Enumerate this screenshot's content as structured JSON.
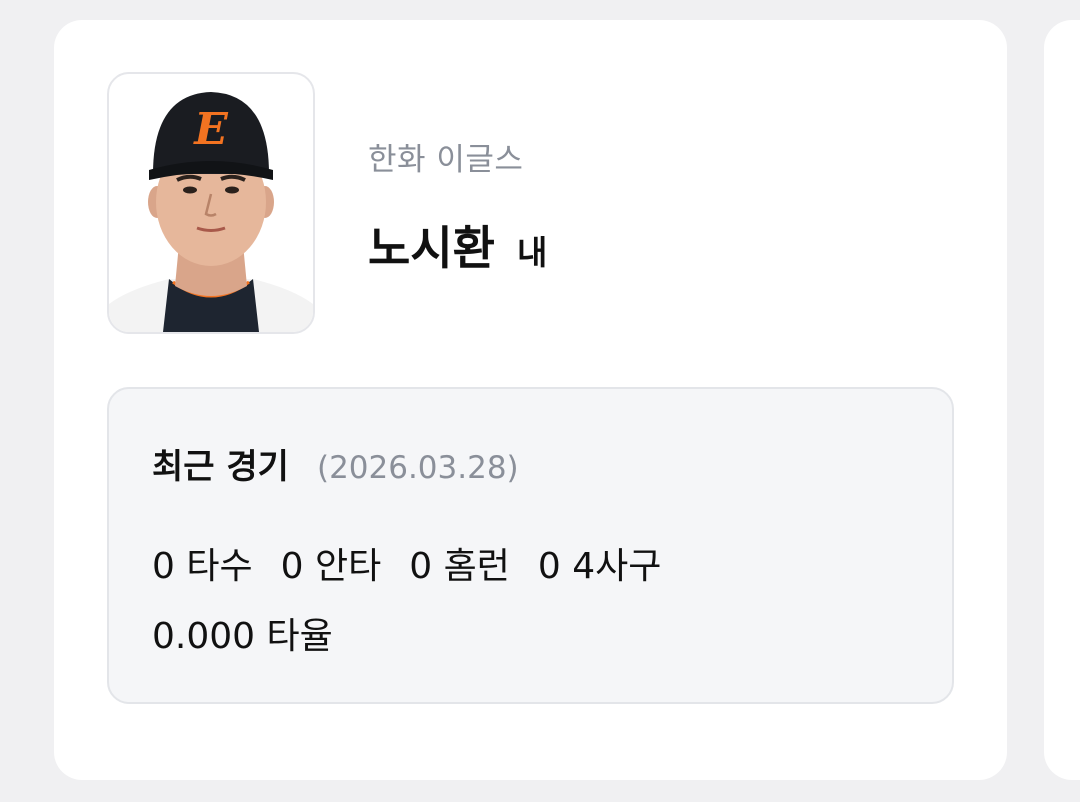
{
  "player": {
    "team": "한화 이글스",
    "name": "노시환",
    "position": "내",
    "photo_icon": "player-photo-icon",
    "cap_logo": "E"
  },
  "recent_game": {
    "title": "최근 경기",
    "date": "(2026.03.28)",
    "stats": [
      {
        "value": "0",
        "label": "타수"
      },
      {
        "value": "0",
        "label": "안타"
      },
      {
        "value": "0",
        "label": "홈런"
      },
      {
        "value": "0",
        "label": "4사구"
      }
    ],
    "average": {
      "value": "0.000",
      "label": "타율"
    }
  },
  "colors": {
    "background": "#f0f0f2",
    "card": "#ffffff",
    "box": "#f5f6f8",
    "text": "#111111",
    "muted": "#8a8f99",
    "accent_orange": "#f37321"
  }
}
